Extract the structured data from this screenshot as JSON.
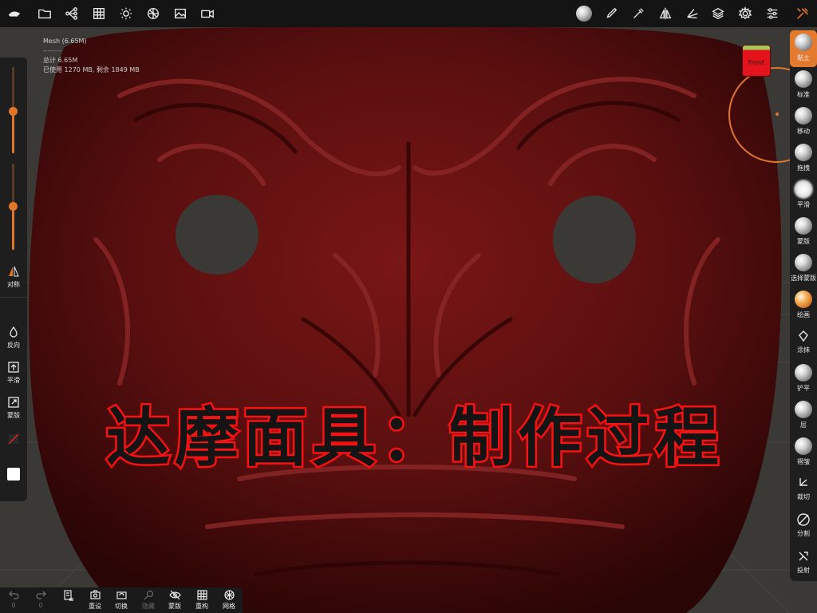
{
  "app": {
    "name": "Nomad Sculpt"
  },
  "stats": {
    "mesh": "Mesh (6.65M)",
    "divider": "--------",
    "total": "总计 6.65M",
    "memory": "已使用 1270 MB, 剩余 1849 MB"
  },
  "title_overlay": "达摩面具：制作过程",
  "gizmo": {
    "front_label": "Front"
  },
  "left_panel": {
    "symmetry_label": "对称",
    "invert_label": "反向",
    "smooth_label": "平滑",
    "mask_label": "蒙版"
  },
  "tools": [
    {
      "label": "黏土",
      "icon": "clay-brush-icon"
    },
    {
      "label": "标准",
      "icon": "standard-brush-icon"
    },
    {
      "label": "移动",
      "icon": "move-brush-icon"
    },
    {
      "label": "拖拽",
      "icon": "drag-brush-icon"
    },
    {
      "label": "平滑",
      "icon": "smooth-brush-icon"
    },
    {
      "label": "蒙版",
      "icon": "mask-brush-icon"
    },
    {
      "label": "选择蒙版",
      "icon": "select-mask-icon"
    },
    {
      "label": "绘画",
      "icon": "paint-brush-icon"
    },
    {
      "label": "涂抹",
      "icon": "smudge-icon"
    },
    {
      "label": "铲平",
      "icon": "flatten-icon"
    },
    {
      "label": "层",
      "icon": "layer-brush-icon"
    },
    {
      "label": "褶皱",
      "icon": "crease-icon"
    },
    {
      "label": "裁切",
      "icon": "trim-icon"
    },
    {
      "label": "分割",
      "icon": "split-icon"
    },
    {
      "label": "投射",
      "icon": "project-icon"
    }
  ],
  "bottom_bar": {
    "undo_count": "0",
    "redo_count": "0",
    "reset_label": "重设",
    "switch_label": "切换",
    "hide_label": "隐藏",
    "mask_label": "蒙版",
    "remesh_label": "重构",
    "wire_label": "网格"
  },
  "colors": {
    "accent": "#e0762a",
    "title_stroke": "#f01010",
    "mask_color": "#5a0f0f",
    "cube_face": "#e5141c"
  }
}
